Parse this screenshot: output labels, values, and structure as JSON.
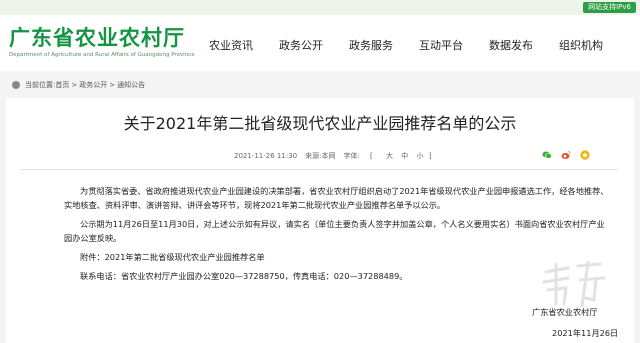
{
  "badge": {
    "ipv6": "网站支持IPv6"
  },
  "header": {
    "title": "广东省农业农村厅",
    "subtitle": "Department of Agriculture and Rural Affairs of Guangdong Province"
  },
  "nav": {
    "items": [
      {
        "label": "农业资讯"
      },
      {
        "label": "政务公开"
      },
      {
        "label": "政务服务"
      },
      {
        "label": "互动平台"
      },
      {
        "label": "数据发布"
      },
      {
        "label": "组织机构"
      }
    ]
  },
  "breadcrumb": {
    "prefix": "当前位置:",
    "items": [
      "首页",
      "政务公开",
      "通知公告"
    ],
    "sep": ">"
  },
  "article": {
    "title": "关于2021年第二批省级现代农业产业园推荐名单的公示",
    "datetime": "2021-11-26 11:30",
    "source": "来源:本网",
    "font_label": "字体:",
    "font_open": "[",
    "font_sizes": [
      "大",
      "中",
      "小"
    ],
    "font_close": "]",
    "paragraphs": [
      "为贯彻落实省委、省政府推进现代农业产业园建设的决策部署，省农业农村厅组织启动了2021年省级现代农业产业园申报遴选工作，经各地推荐、实地核查、资料评审、演讲答辩、讲评会等环节，现将2021年第二批现代农业产业园推荐名单予以公示。",
      "公示期为11月26日至11月30日，对上述公示如有异议，请实名（单位主要负责人签字并加盖公章，个人名义要用实名）书面向省农业农村厅产业园办公室反映。",
      "附件：2021年第二批省级现代农业产业园推荐名单",
      "联系电话：省农业农村厅产业园办公室020—37288750，传真电话：020—37288489。"
    ],
    "signature": "广东省农业农村厅",
    "date": "2021年11月26日"
  },
  "share": {
    "icons": [
      "wechat-icon",
      "weibo-icon",
      "qq-icon"
    ],
    "colors": [
      "#3cb034",
      "#e2532e",
      "#f0b400"
    ]
  }
}
